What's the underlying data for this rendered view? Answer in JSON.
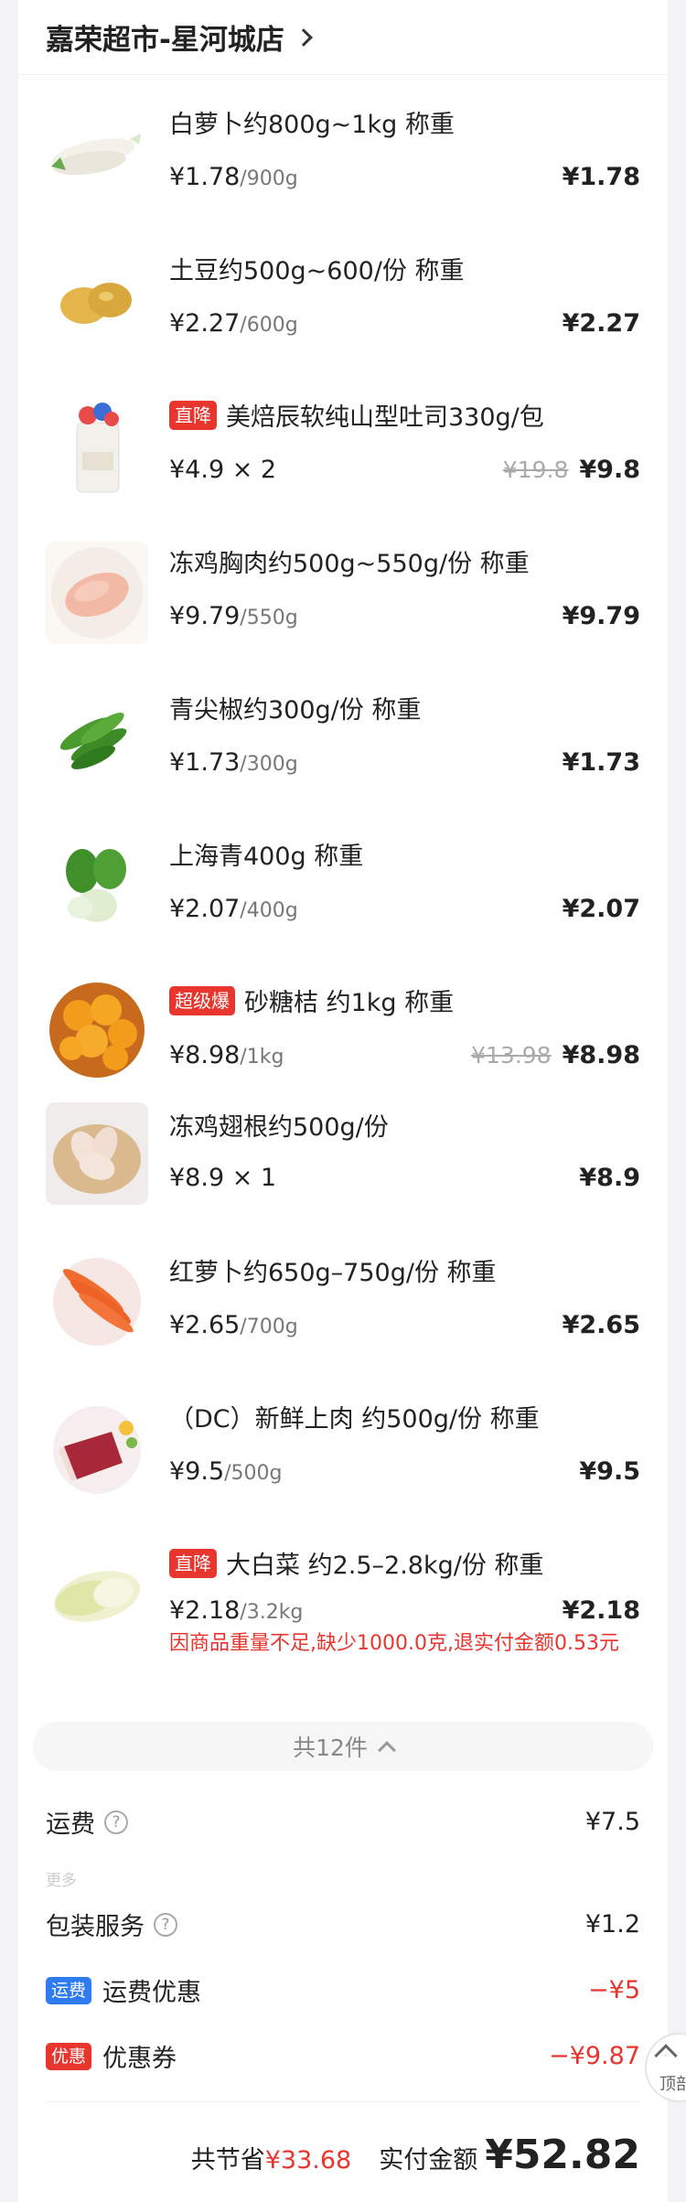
{
  "store": {
    "name": "嘉荣超市-星河城店"
  },
  "items": [
    {
      "name": "白萝卜约800g~1kg 称重",
      "badge": "",
      "price": "¥1.78",
      "unit": "/900g",
      "original": "",
      "total": "¥1.78",
      "refund": ""
    },
    {
      "name": "土豆约500g~600/份 称重",
      "badge": "",
      "price": "¥2.27",
      "unit": "/600g",
      "original": "",
      "total": "¥2.27",
      "refund": ""
    },
    {
      "name": "美焙辰软纯山型吐司330g/包",
      "badge": "直降",
      "price": "¥4.9 × 2",
      "unit": "",
      "original": "¥19.8",
      "total": "¥9.8",
      "refund": ""
    },
    {
      "name": "冻鸡胸肉约500g~550g/份 称重",
      "badge": "",
      "price": "¥9.79",
      "unit": "/550g",
      "original": "",
      "total": "¥9.79",
      "refund": ""
    },
    {
      "name": "青尖椒约300g/份 称重",
      "badge": "",
      "price": "¥1.73",
      "unit": "/300g",
      "original": "",
      "total": "¥1.73",
      "refund": ""
    },
    {
      "name": "上海青400g 称重",
      "badge": "",
      "price": "¥2.07",
      "unit": "/400g",
      "original": "",
      "total": "¥2.07",
      "refund": ""
    },
    {
      "name": "砂糖桔 约1kg 称重",
      "badge": "超级爆",
      "price": "¥8.98",
      "unit": "/1kg",
      "original": "¥13.98",
      "total": "¥8.98",
      "refund": ""
    },
    {
      "name": "冻鸡翅根约500g/份",
      "badge": "",
      "price": "¥8.9 × 1",
      "unit": "",
      "original": "",
      "total": "¥8.9",
      "refund": ""
    },
    {
      "name": "红萝卜约650g–750g/份 称重",
      "badge": "",
      "price": "¥2.65",
      "unit": "/700g",
      "original": "",
      "total": "¥2.65",
      "refund": ""
    },
    {
      "name": "（DC）新鲜上肉 约500g/份 称重",
      "badge": "",
      "price": "¥9.5",
      "unit": "/500g",
      "original": "",
      "total": "¥9.5",
      "refund": ""
    },
    {
      "name": "大白菜 约2.5–2.8kg/份 称重",
      "badge": "直降",
      "price": "¥2.18",
      "unit": "/3.2kg",
      "original": "",
      "total": "¥2.18",
      "refund": "因商品重量不足,缺少1000.0克,退实付金额0.53元"
    }
  ],
  "summary": {
    "count_label": "共12件",
    "shipping_label": "运费",
    "shipping_value": "¥7.5",
    "more_label": "更多",
    "packaging_label": "包装服务",
    "packaging_value": "¥1.2",
    "ship_discount_tag": "运费",
    "ship_discount_label": "运费优惠",
    "ship_discount_value": "−¥5",
    "coupon_tag": "优惠",
    "coupon_label": "优惠券",
    "coupon_value": "−¥9.87",
    "save_label": "共节省",
    "save_value": "¥33.68",
    "pay_label": "实付金额",
    "pay_value": "¥52.82"
  },
  "back_to_top": "顶部",
  "colors": {
    "accent_red": "#e8362f",
    "ship_tag_blue": "#2f7bf0"
  }
}
